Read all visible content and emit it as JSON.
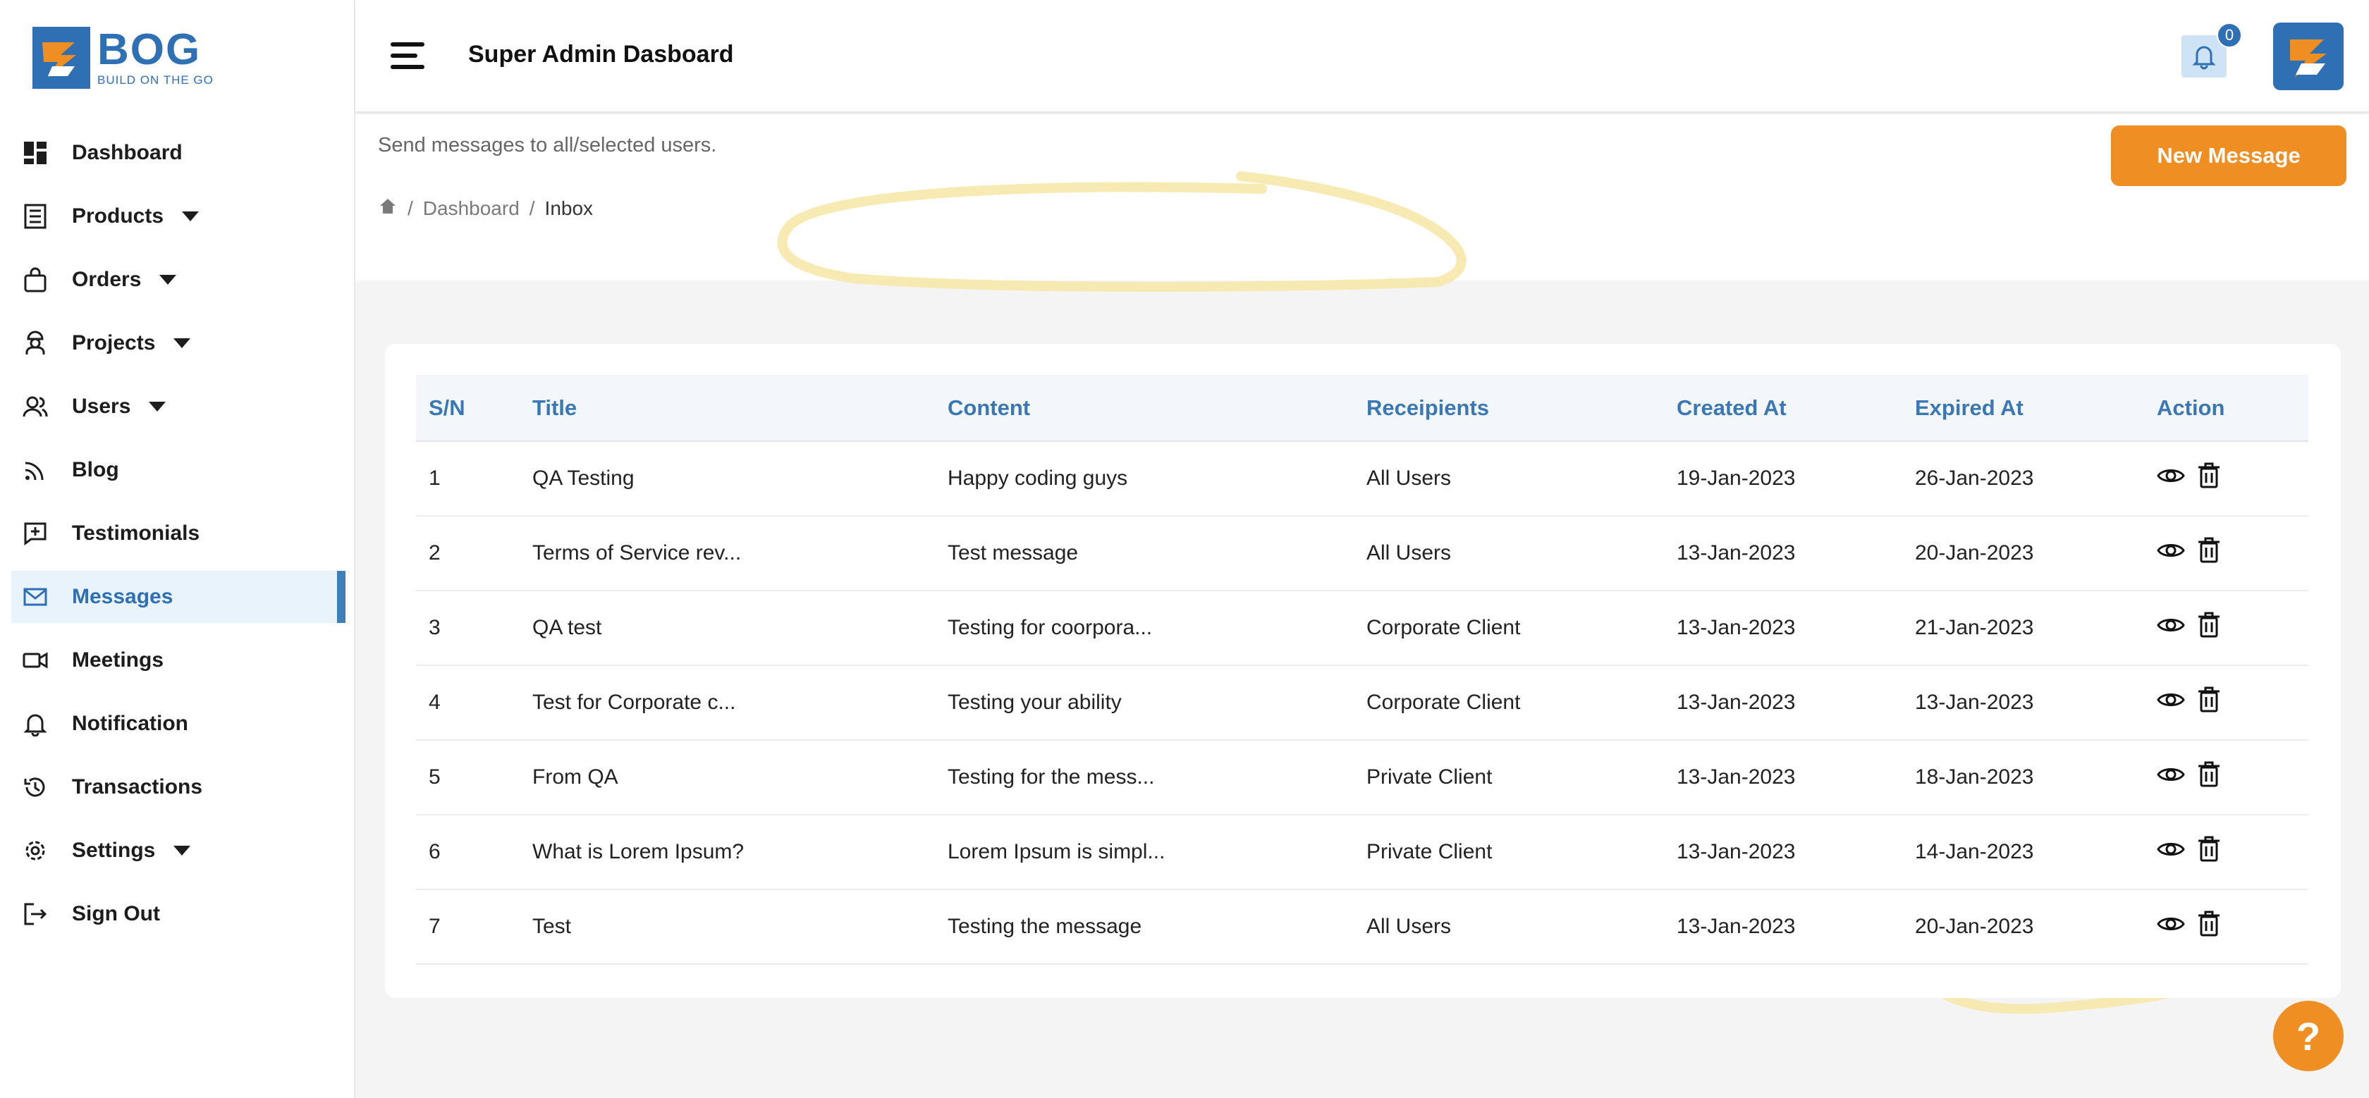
{
  "brand": {
    "name": "BOG",
    "tagline": "BUILD ON THE GO",
    "primary_color": "#2f6fb3",
    "accent_color": "#ef8e22"
  },
  "sidebar": {
    "items": [
      {
        "label": "Dashboard",
        "icon": "dashboard-icon",
        "has_caret": false,
        "active": false
      },
      {
        "label": "Products",
        "icon": "products-icon",
        "has_caret": true,
        "active": false
      },
      {
        "label": "Orders",
        "icon": "bag-icon",
        "has_caret": true,
        "active": false
      },
      {
        "label": "Projects",
        "icon": "worker-icon",
        "has_caret": true,
        "active": false
      },
      {
        "label": "Users",
        "icon": "users-icon",
        "has_caret": true,
        "active": false
      },
      {
        "label": "Blog",
        "icon": "rss-icon",
        "has_caret": false,
        "active": false
      },
      {
        "label": "Testimonials",
        "icon": "testimonial-icon",
        "has_caret": false,
        "active": false
      },
      {
        "label": "Messages",
        "icon": "mail-icon",
        "has_caret": false,
        "active": true
      },
      {
        "label": "Meetings",
        "icon": "video-icon",
        "has_caret": false,
        "active": false
      },
      {
        "label": "Notification",
        "icon": "bell-icon",
        "has_caret": false,
        "active": false
      },
      {
        "label": "Transactions",
        "icon": "history-icon",
        "has_caret": false,
        "active": false
      },
      {
        "label": "Settings",
        "icon": "gear-icon",
        "has_caret": true,
        "active": false
      },
      {
        "label": "Sign Out",
        "icon": "sign-out-icon",
        "has_caret": false,
        "active": false
      }
    ]
  },
  "header": {
    "title": "Super Admin Dasboard",
    "notification_count": "0"
  },
  "page": {
    "subtitle": "Send messages to all/selected users.",
    "breadcrumb": {
      "home_icon": "home-icon",
      "dashboard": "Dashboard",
      "current": "Inbox"
    },
    "new_message_label": "New Message"
  },
  "table": {
    "columns": [
      "S/N",
      "Title",
      "Content",
      "Receipients",
      "Created At",
      "Expired At",
      "Action"
    ],
    "rows": [
      [
        "1",
        "QA Testing",
        "Happy coding guys",
        "All Users",
        "19-Jan-2023",
        "26-Jan-2023"
      ],
      [
        "2",
        "Terms of Service rev...",
        "Test message",
        "All Users",
        "13-Jan-2023",
        "20-Jan-2023"
      ],
      [
        "3",
        "QA test",
        "Testing for coorpora...",
        "Corporate Client",
        "13-Jan-2023",
        "21-Jan-2023"
      ],
      [
        "4",
        "Test for Corporate c...",
        "Testing your ability",
        "Corporate Client",
        "13-Jan-2023",
        "13-Jan-2023"
      ],
      [
        "5",
        "From QA",
        "Testing for the mess...",
        "Private Client",
        "13-Jan-2023",
        "18-Jan-2023"
      ],
      [
        "6",
        "What is Lorem Ipsum?",
        "Lorem Ipsum is simpl...",
        "Private Client",
        "13-Jan-2023",
        "14-Jan-2023"
      ],
      [
        "7",
        "Test",
        "Testing the message",
        "All Users",
        "13-Jan-2023",
        "20-Jan-2023"
      ]
    ],
    "row_actions": [
      "eye-icon",
      "trash-icon"
    ]
  },
  "help": {
    "label": "?"
  }
}
